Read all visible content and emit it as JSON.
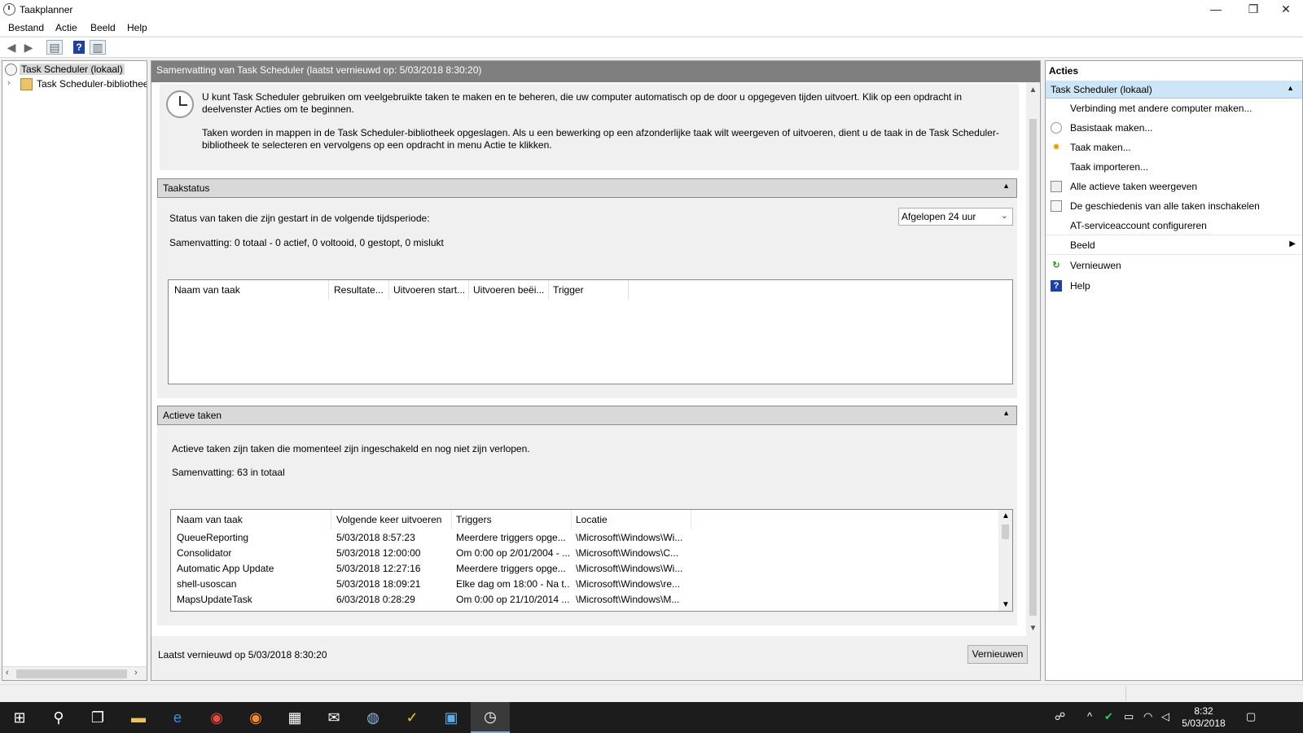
{
  "window": {
    "title": "Taakplanner",
    "controls": [
      "—",
      "❐",
      "✕"
    ]
  },
  "menu": [
    "Bestand",
    "Actie",
    "Beeld",
    "Help"
  ],
  "tree": {
    "root": "Task Scheduler (lokaal)",
    "child": "Task Scheduler-bibliotheek"
  },
  "main": {
    "header": "Samenvatting van Task Scheduler (laatst vernieuwd op: 5/03/2018 8:30:20)",
    "intro1": "U kunt Task Scheduler gebruiken om veelgebruikte taken te maken en te beheren, die uw computer automatisch op de door u opgegeven tijden uitvoert. Klik op een opdracht in deelvenster Acties om te beginnen.",
    "intro2": "Taken worden in mappen in de Task Scheduler-bibliotheek opgeslagen. Als u een bewerking op een afzonderlijke taak wilt weergeven of uitvoeren, dient u de taak in de Task Scheduler-bibliotheek te selecteren en vervolgens op een opdracht in menu Actie te klikken.",
    "taakstatus": {
      "title": "Taakstatus",
      "period_label": "Status van taken die zijn gestart in de volgende tijdsperiode:",
      "period_value": "Afgelopen 24 uur",
      "summary": "Samenvatting: 0 totaal - 0 actief, 0 voltooid, 0 gestopt, 0 mislukt",
      "columns": [
        "Naam van taak",
        "Resultate...",
        "Uitvoeren start...",
        "Uitvoeren beëi...",
        "Trigger"
      ]
    },
    "actieve": {
      "title": "Actieve taken",
      "description": "Actieve taken zijn taken die momenteel zijn ingeschakeld en nog niet zijn verlopen.",
      "summary": "Samenvatting: 63 in totaal",
      "columns": [
        "Naam van taak",
        "Volgende keer uitvoeren",
        "Triggers",
        "Locatie"
      ],
      "rows": [
        [
          "QueueReporting",
          "5/03/2018 8:57:23",
          "Meerdere triggers opge...",
          "\\Microsoft\\Windows\\Wi..."
        ],
        [
          "Consolidator",
          "5/03/2018 12:00:00",
          "Om 0:00 op 2/01/2004 - ...",
          "\\Microsoft\\Windows\\C..."
        ],
        [
          "Automatic App Update",
          "5/03/2018 12:27:16",
          "Meerdere triggers opge...",
          "\\Microsoft\\Windows\\Wi..."
        ],
        [
          "shell-usoscan",
          "5/03/2018 18:09:21",
          "Elke dag om 18:00 - Na t...",
          "\\Microsoft\\Windows\\re..."
        ],
        [
          "MapsUpdateTask",
          "6/03/2018 0:28:29",
          "Om 0:00 op 21/10/2014 ...",
          "\\Microsoft\\Windows\\M..."
        ]
      ]
    },
    "footer": {
      "last_refresh": "Laatst vernieuwd op 5/03/2018 8:30:20",
      "refresh_button": "Vernieuwen"
    }
  },
  "actions": {
    "title": "Acties",
    "group": "Task Scheduler (lokaal)",
    "items": [
      {
        "label": "Verbinding met andere computer maken...",
        "icon": "none"
      },
      {
        "label": "Basistaak maken...",
        "icon": "basic-task-icon"
      },
      {
        "label": "Taak maken...",
        "icon": "create-task-icon"
      },
      {
        "label": "Taak importeren...",
        "icon": "none"
      },
      {
        "label": "Alle actieve taken weergeven",
        "icon": "running-tasks-icon"
      },
      {
        "label": "De geschiedenis van alle taken inschakelen",
        "icon": "history-icon"
      },
      {
        "label": "AT-serviceaccount configureren",
        "icon": "none"
      },
      {
        "label": "Beeld",
        "icon": "none"
      },
      {
        "label": "Vernieuwen",
        "icon": "refresh-icon"
      },
      {
        "label": "Help",
        "icon": "help-icon"
      }
    ]
  },
  "taskbar": {
    "time": "8:32",
    "date": "5/03/2018"
  },
  "colors": {
    "header_gray": "#7f7f7f",
    "section_gray": "#d9d9d9",
    "selected_blue": "#cde6f7",
    "taskbar": "#1c1c1c"
  }
}
